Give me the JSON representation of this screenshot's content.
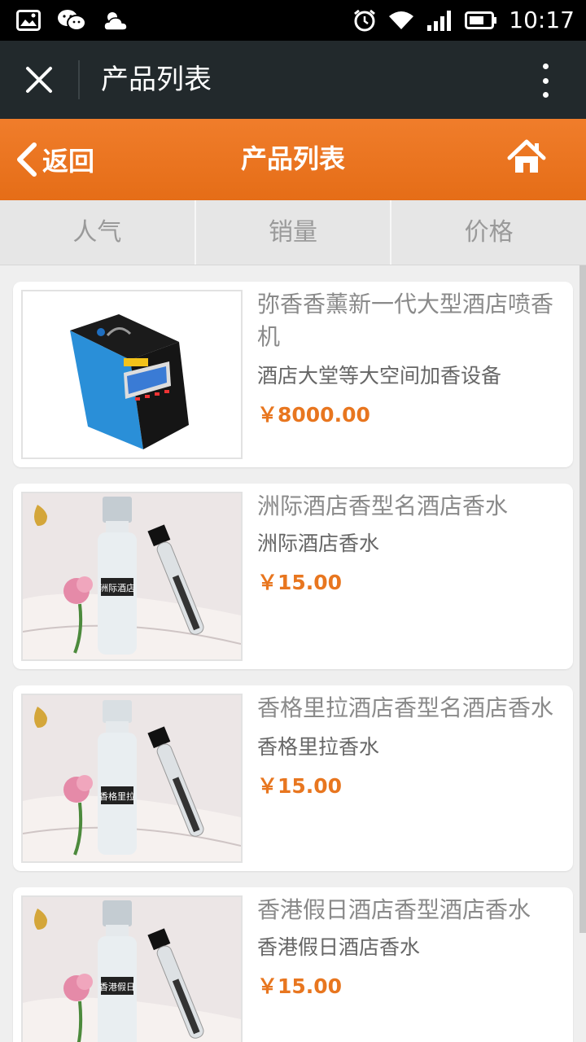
{
  "status_bar": {
    "time": "10:17"
  },
  "wechat_bar": {
    "title": "产品列表"
  },
  "header": {
    "back_label": "返回",
    "title": "产品列表"
  },
  "sort_tabs": [
    {
      "label": "人气"
    },
    {
      "label": "销量"
    },
    {
      "label": "价格"
    }
  ],
  "products": [
    {
      "name": "弥香香薰新一代大型酒店喷香机",
      "subtitle": "酒店大堂等大空间加香设备",
      "price": "￥8000.00"
    },
    {
      "name": "洲际酒店香型名酒店香水",
      "subtitle": "洲际酒店香水",
      "price": "￥15.00",
      "bottle_label": "洲际酒店"
    },
    {
      "name": "香格里拉酒店香型名酒店香水",
      "subtitle": "香格里拉香水",
      "price": "￥15.00",
      "bottle_label": "香格里拉"
    },
    {
      "name": "香港假日酒店香型酒店香水",
      "subtitle": "香港假日酒店香水",
      "price": "￥15.00",
      "bottle_label": "香港假日"
    }
  ],
  "colors": {
    "accent": "#e8761f",
    "header": "#ec7520",
    "wechat_bar": "#22292c"
  }
}
